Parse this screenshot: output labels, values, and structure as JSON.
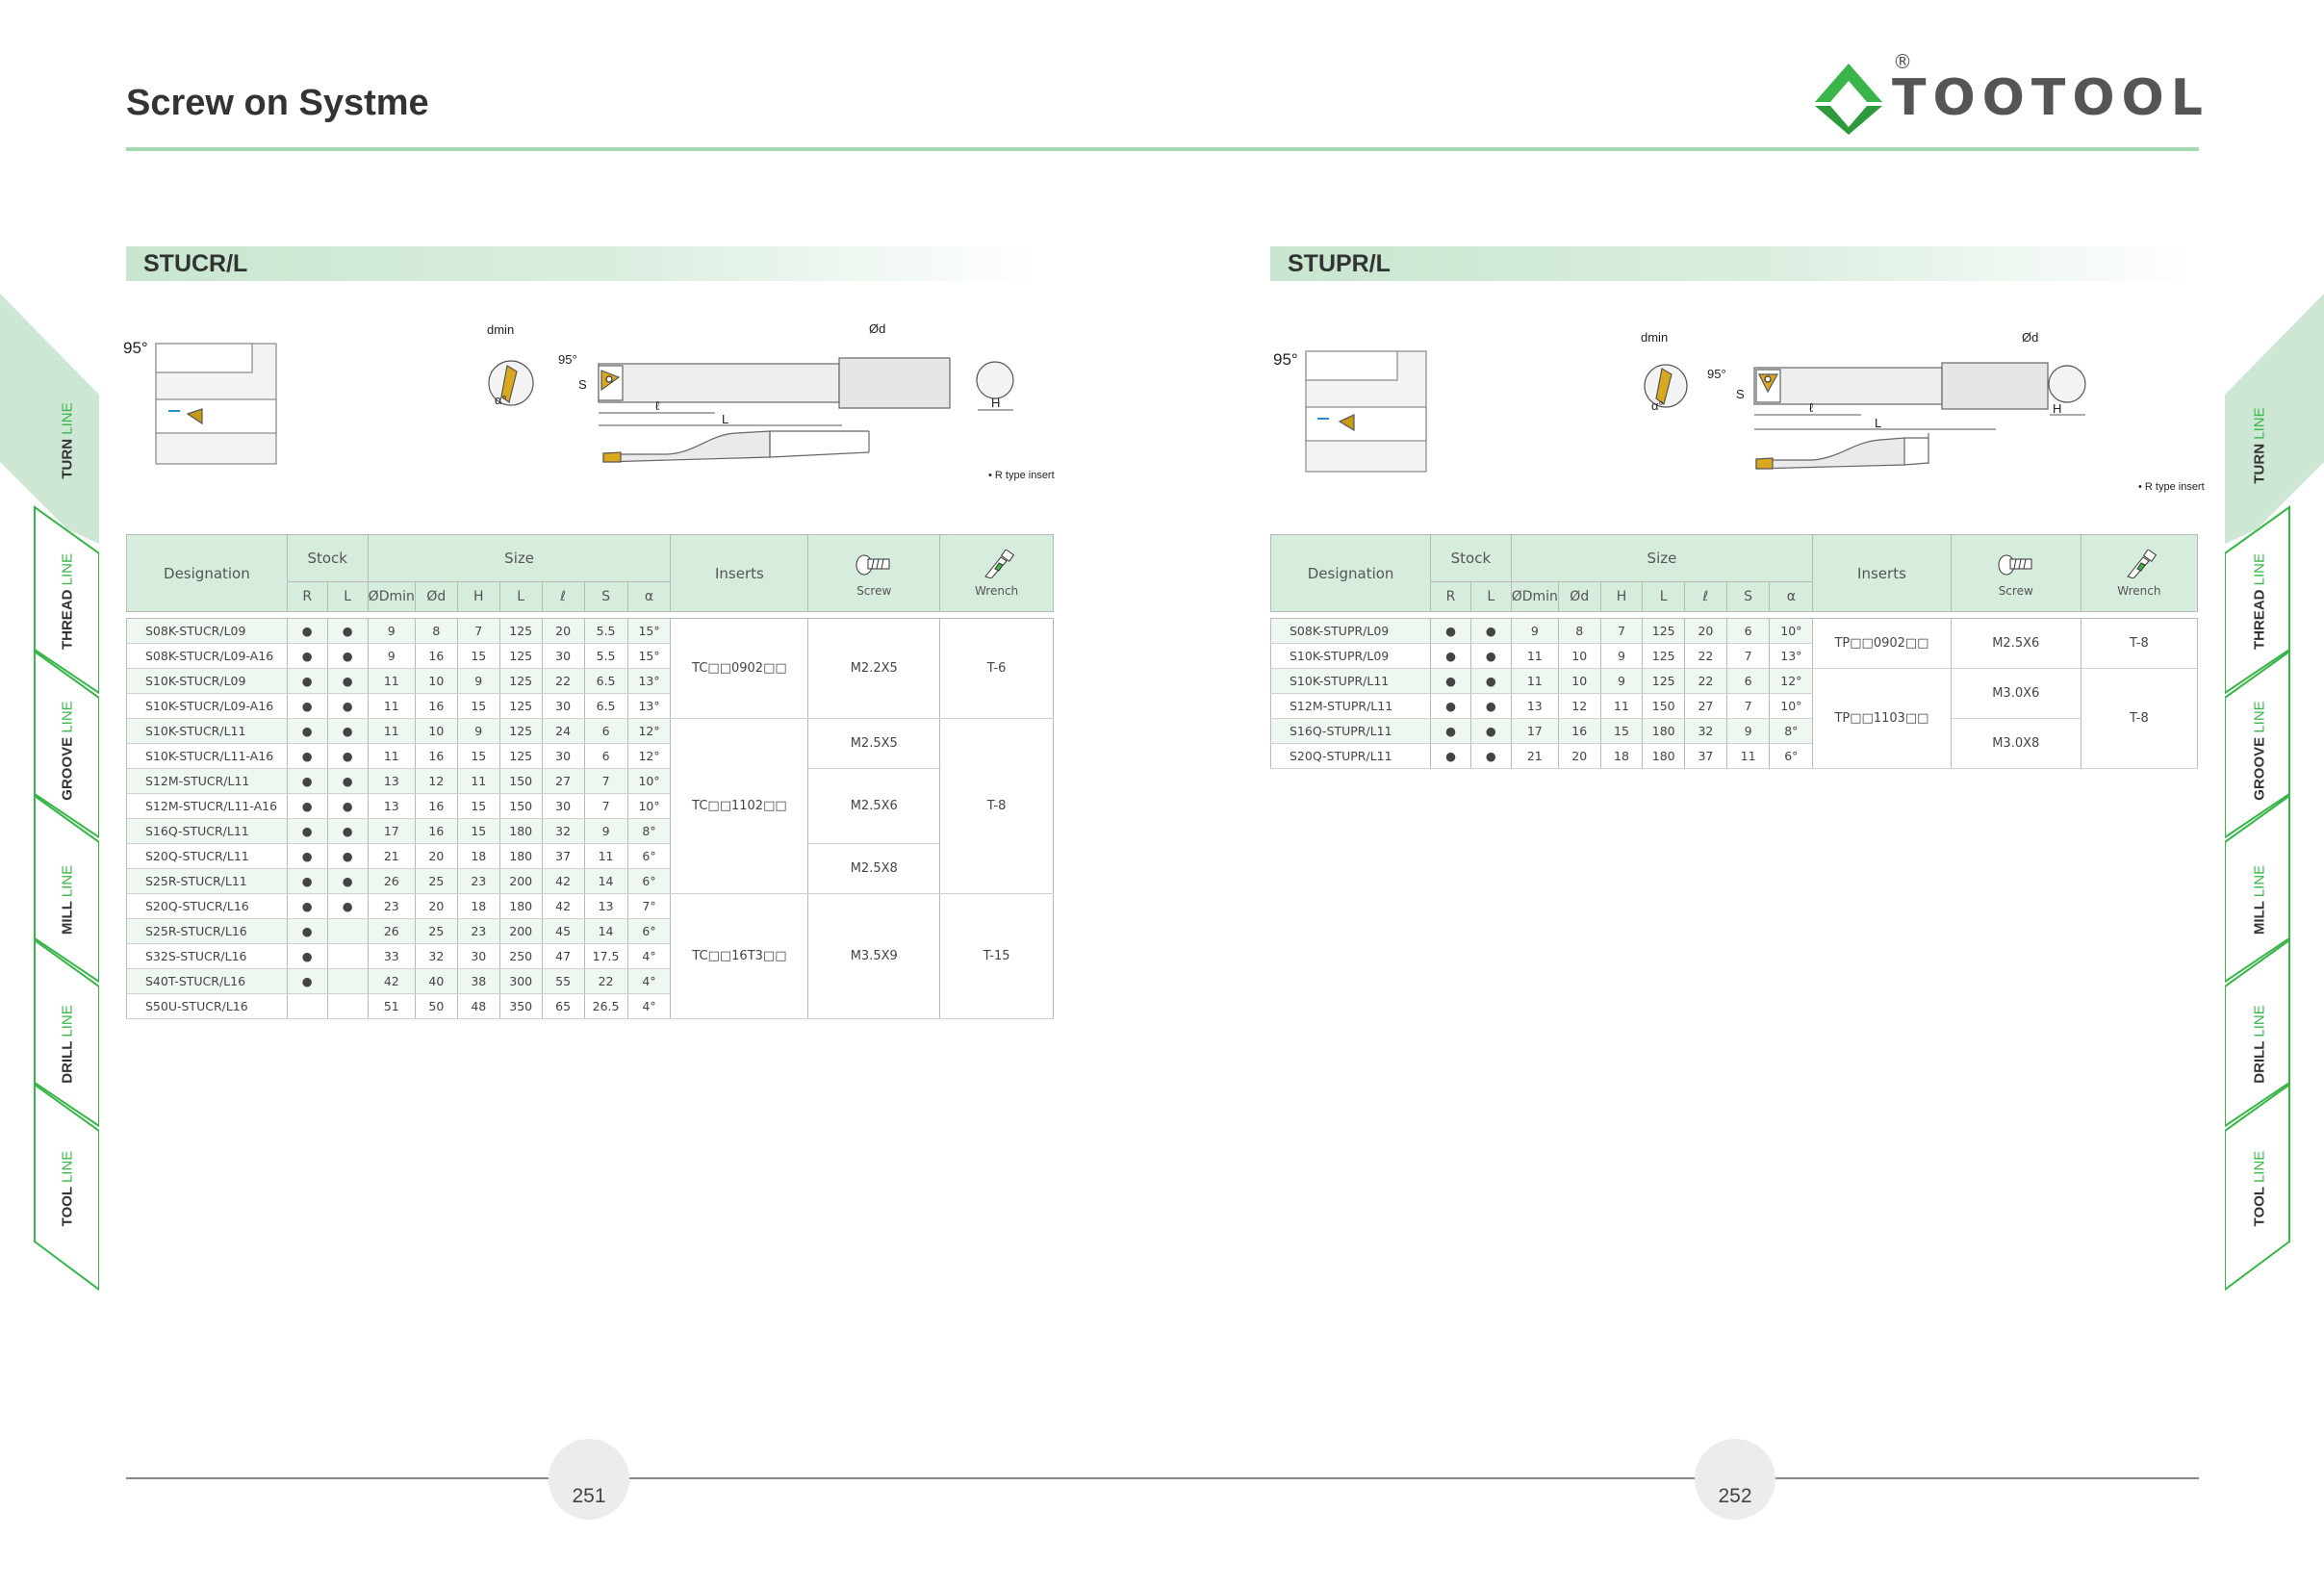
{
  "header": {
    "title": "Screw on Systme",
    "logo_text": "TOOTOOL",
    "logo_reg": "®"
  },
  "colors": {
    "accent": "#39b54a",
    "header_fill": "#d6ecdc",
    "rule": "#a7d9b5"
  },
  "side_tabs": [
    {
      "bold": "TURN",
      "thin": "LINE",
      "active": true
    },
    {
      "bold": "THREAD",
      "thin": "LINE",
      "active": false
    },
    {
      "bold": "GROOVE",
      "thin": "LINE",
      "active": false
    },
    {
      "bold": "MILL",
      "thin": "LINE",
      "active": false
    },
    {
      "bold": "DRILL",
      "thin": "LINE",
      "active": false
    },
    {
      "bold": "TOOL",
      "thin": "LINE",
      "active": false
    }
  ],
  "columns": {
    "designation": "Designation",
    "stock": "Stock",
    "size": "Size",
    "inserts": "Inserts",
    "screw": "Screw",
    "wrench": "Wrench",
    "sub": [
      "R",
      "L",
      "ØDmin",
      "Ød",
      "H",
      "L",
      "ℓ",
      "S",
      "α"
    ],
    "screw_icon": "screw-icon",
    "wrench_icon": "wrench-icon"
  },
  "sections": [
    {
      "title": "STUCR/L",
      "diagram": {
        "angle": "95°",
        "dmin": "dmin",
        "alpha": "α°",
        "s": "S",
        "l": "ℓ",
        "L": "L",
        "d": "Ød",
        "H": "H",
        "note": "• R type insert",
        "angle2": "95°"
      },
      "rows": [
        {
          "des": "S08K-STUCR/L09",
          "r": "●",
          "l": "●",
          "Dmin": "9",
          "d": "8",
          "H": "7",
          "L": "125",
          "ll": "20",
          "S": "5.5",
          "a": "15°"
        },
        {
          "des": "S08K-STUCR/L09-A16",
          "r": "●",
          "l": "●",
          "Dmin": "9",
          "d": "16",
          "H": "15",
          "L": "125",
          "ll": "30",
          "S": "5.5",
          "a": "15°"
        },
        {
          "des": "S10K-STUCR/L09",
          "r": "●",
          "l": "●",
          "Dmin": "11",
          "d": "10",
          "H": "9",
          "L": "125",
          "ll": "22",
          "S": "6.5",
          "a": "13°"
        },
        {
          "des": "S10K-STUCR/L09-A16",
          "r": "●",
          "l": "●",
          "Dmin": "11",
          "d": "16",
          "H": "15",
          "L": "125",
          "ll": "30",
          "S": "6.5",
          "a": "13°"
        },
        {
          "des": "S10K-STUCR/L11",
          "r": "●",
          "l": "●",
          "Dmin": "11",
          "d": "10",
          "H": "9",
          "L": "125",
          "ll": "24",
          "S": "6",
          "a": "12°"
        },
        {
          "des": "S10K-STUCR/L11-A16",
          "r": "●",
          "l": "●",
          "Dmin": "11",
          "d": "16",
          "H": "15",
          "L": "125",
          "ll": "30",
          "S": "6",
          "a": "12°"
        },
        {
          "des": "S12M-STUCR/L11",
          "r": "●",
          "l": "●",
          "Dmin": "13",
          "d": "12",
          "H": "11",
          "L": "150",
          "ll": "27",
          "S": "7",
          "a": "10°"
        },
        {
          "des": "S12M-STUCR/L11-A16",
          "r": "●",
          "l": "●",
          "Dmin": "13",
          "d": "16",
          "H": "15",
          "L": "150",
          "ll": "30",
          "S": "7",
          "a": "10°"
        },
        {
          "des": "S16Q-STUCR/L11",
          "r": "●",
          "l": "●",
          "Dmin": "17",
          "d": "16",
          "H": "15",
          "L": "180",
          "ll": "32",
          "S": "9",
          "a": "8°"
        },
        {
          "des": "S20Q-STUCR/L11",
          "r": "●",
          "l": "●",
          "Dmin": "21",
          "d": "20",
          "H": "18",
          "L": "180",
          "ll": "37",
          "S": "11",
          "a": "6°"
        },
        {
          "des": "S25R-STUCR/L11",
          "r": "●",
          "l": "●",
          "Dmin": "26",
          "d": "25",
          "H": "23",
          "L": "200",
          "ll": "42",
          "S": "14",
          "a": "6°"
        },
        {
          "des": "S20Q-STUCR/L16",
          "r": "●",
          "l": "●",
          "Dmin": "23",
          "d": "20",
          "H": "18",
          "L": "180",
          "ll": "42",
          "S": "13",
          "a": "7°"
        },
        {
          "des": "S25R-STUCR/L16",
          "r": "●",
          "l": "",
          "Dmin": "26",
          "d": "25",
          "H": "23",
          "L": "200",
          "ll": "45",
          "S": "14",
          "a": "6°"
        },
        {
          "des": "S32S-STUCR/L16",
          "r": "●",
          "l": "",
          "Dmin": "33",
          "d": "32",
          "H": "30",
          "L": "250",
          "ll": "47",
          "S": "17.5",
          "a": "4°"
        },
        {
          "des": "S40T-STUCR/L16",
          "r": "●",
          "l": "",
          "Dmin": "42",
          "d": "40",
          "H": "38",
          "L": "300",
          "ll": "55",
          "S": "22",
          "a": "4°"
        },
        {
          "des": "S50U-STUCR/L16",
          "r": "",
          "l": "",
          "Dmin": "51",
          "d": "50",
          "H": "48",
          "L": "350",
          "ll": "65",
          "S": "26.5",
          "a": "4°"
        }
      ],
      "inserts": [
        "TC□□0902□□",
        "TC□□1102□□",
        "TC□□16T3□□"
      ],
      "screws": [
        "M2.2X5",
        "M2.5X5",
        "M2.5X6",
        "M2.5X8",
        "M3.5X9"
      ],
      "wrenches": [
        "T-6",
        "T-8",
        "T-15"
      ]
    },
    {
      "title": "STUPR/L",
      "diagram": {
        "angle": "95°",
        "dmin": "dmin",
        "alpha": "α°",
        "s": "S",
        "l": "ℓ",
        "L": "L",
        "d": "Ød",
        "H": "H",
        "note": "• R type insert",
        "angle2": "95°"
      },
      "rows": [
        {
          "des": "S08K-STUPR/L09",
          "r": "●",
          "l": "●",
          "Dmin": "9",
          "d": "8",
          "H": "7",
          "L": "125",
          "ll": "20",
          "S": "6",
          "a": "10°"
        },
        {
          "des": "S10K-STUPR/L09",
          "r": "●",
          "l": "●",
          "Dmin": "11",
          "d": "10",
          "H": "9",
          "L": "125",
          "ll": "22",
          "S": "7",
          "a": "13°"
        },
        {
          "des": "S10K-STUPR/L11",
          "r": "●",
          "l": "●",
          "Dmin": "11",
          "d": "10",
          "H": "9",
          "L": "125",
          "ll": "22",
          "S": "6",
          "a": "12°"
        },
        {
          "des": "S12M-STUPR/L11",
          "r": "●",
          "l": "●",
          "Dmin": "13",
          "d": "12",
          "H": "11",
          "L": "150",
          "ll": "27",
          "S": "7",
          "a": "10°"
        },
        {
          "des": "S16Q-STUPR/L11",
          "r": "●",
          "l": "●",
          "Dmin": "17",
          "d": "16",
          "H": "15",
          "L": "180",
          "ll": "32",
          "S": "9",
          "a": "8°"
        },
        {
          "des": "S20Q-STUPR/L11",
          "r": "●",
          "l": "●",
          "Dmin": "21",
          "d": "20",
          "H": "18",
          "L": "180",
          "ll": "37",
          "S": "11",
          "a": "6°"
        }
      ],
      "inserts": [
        "TP□□0902□□",
        "TP□□1103□□"
      ],
      "screws": [
        "M2.5X6",
        "M3.0X6",
        "M3.0X8"
      ],
      "wrenches": [
        "T-8",
        "T-8"
      ]
    }
  ],
  "footer": {
    "page_left": "251",
    "page_right": "252"
  }
}
